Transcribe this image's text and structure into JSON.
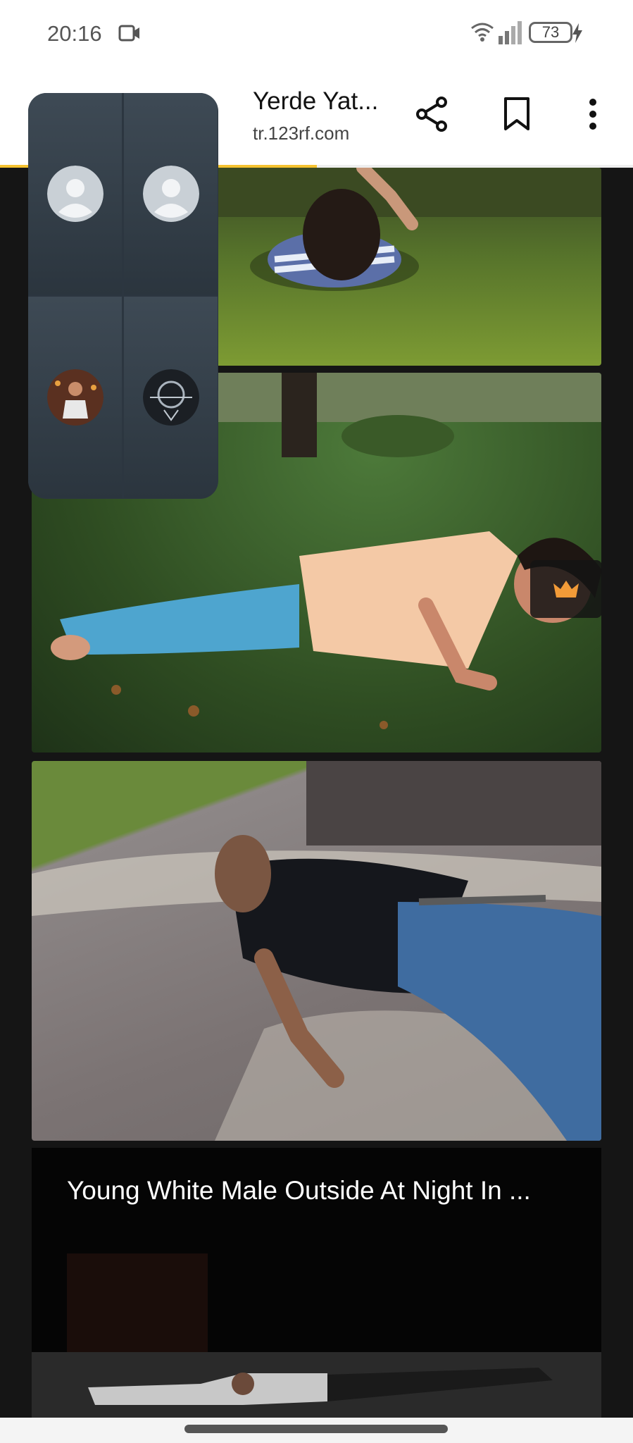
{
  "status_bar": {
    "time": "20:16",
    "battery": "73"
  },
  "browser": {
    "title": "Yerde Yat...",
    "url": "tr.123rf.com",
    "progress_percent": 50,
    "icons": {
      "share": "share-icon",
      "bookmark": "bookmark-icon",
      "menu": "more-vert-icon"
    }
  },
  "results": {
    "card4_title": "Young White Male Outside At Night In ..."
  },
  "call_overlay": {
    "participants": [
      "default-avatar",
      "default-avatar",
      "photo-avatar",
      "photo-avatar"
    ]
  },
  "colors": {
    "progress": "#f5c230",
    "crown": "#f29b38"
  }
}
